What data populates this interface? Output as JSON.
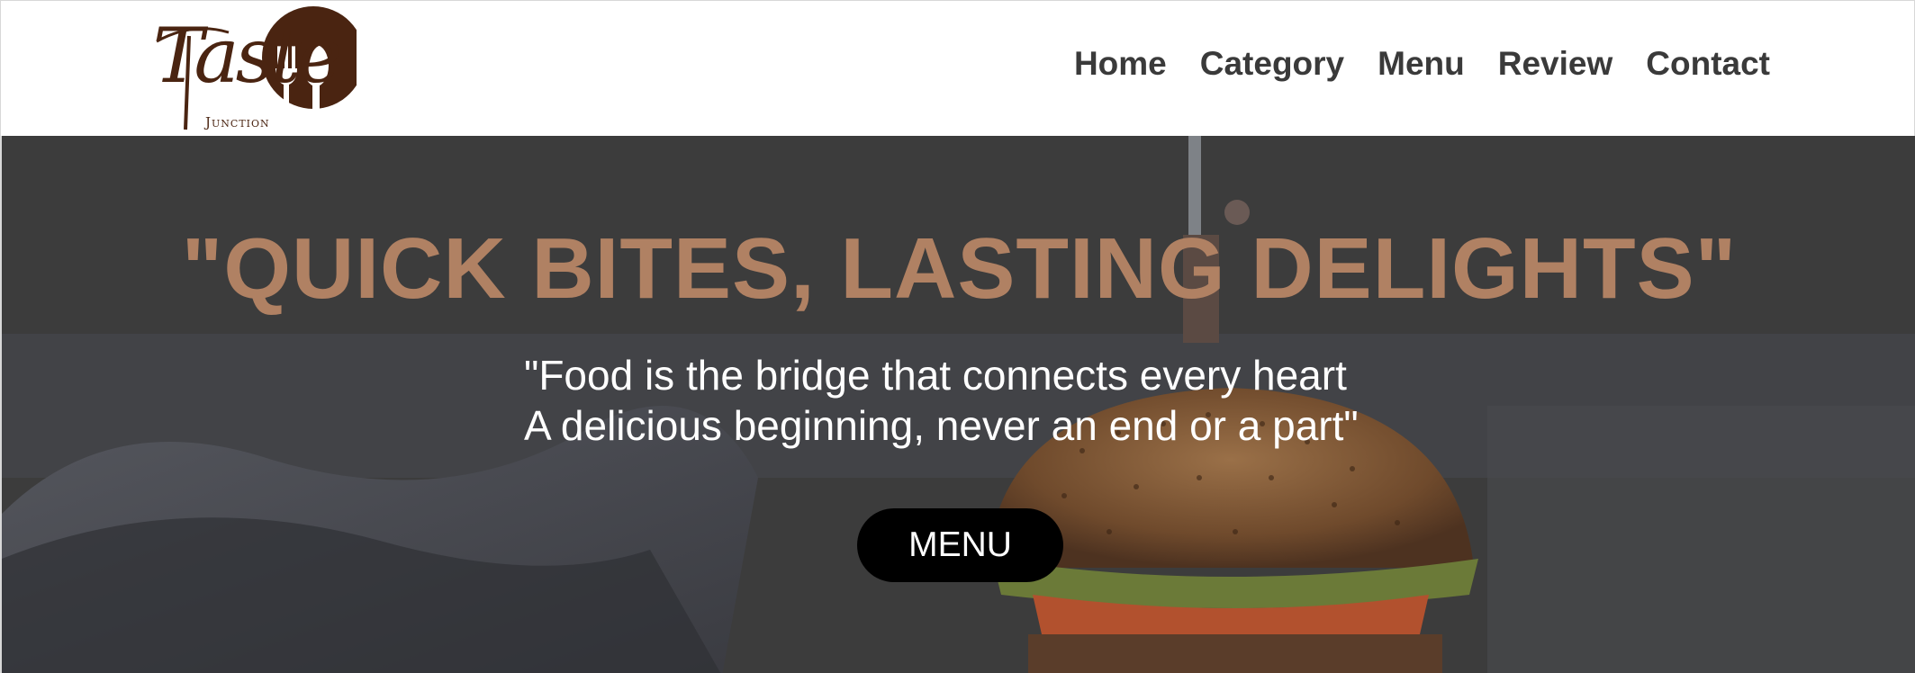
{
  "brand": {
    "logo_script": "Taste",
    "logo_sub": "Junction",
    "colors": {
      "logo": "#4a2411",
      "accent": "#b08163",
      "nav_text": "#3a3a3a"
    }
  },
  "nav": {
    "items": [
      {
        "label": "Home"
      },
      {
        "label": "Category"
      },
      {
        "label": "Menu"
      },
      {
        "label": "Review"
      },
      {
        "label": "Contact"
      }
    ]
  },
  "hero": {
    "title": "\"QUICK BITES, LASTING DELIGHTS\"",
    "quote_line_1": "\"Food is the bridge that connects every heart",
    "quote_line_2": "A delicious beginning, never an end or a part\"",
    "cta_label": "MENU",
    "background_icon": "burger-photo"
  }
}
